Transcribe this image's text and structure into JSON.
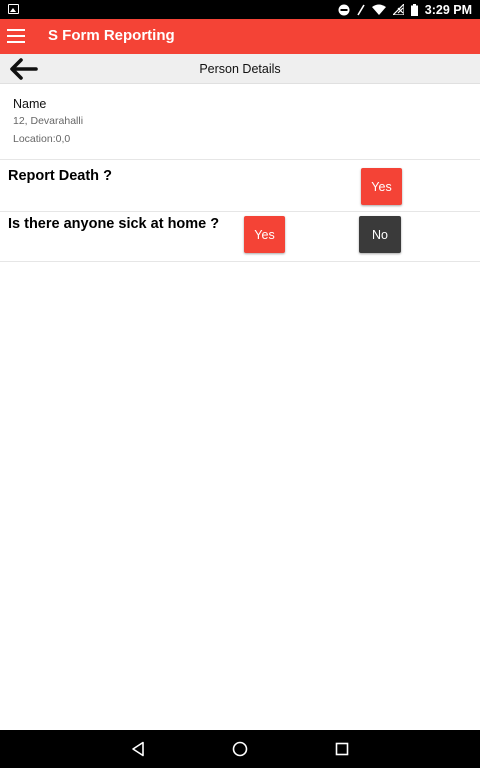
{
  "status_bar": {
    "time": "3:29 PM",
    "icons": [
      "image-notification-icon",
      "do-not-disturb-icon",
      "no-sim-icon",
      "wifi-icon",
      "signal-icon",
      "battery-icon"
    ]
  },
  "app_bar": {
    "title": "S Form Reporting",
    "color": "#f44336"
  },
  "sub_header": {
    "title": "Person Details"
  },
  "person": {
    "name": "Name",
    "address": "12, Devarahalli",
    "location": "Location:0,0"
  },
  "questions": [
    {
      "text": "Report Death ?",
      "yes_label": "Yes"
    },
    {
      "text": "Is there anyone sick at home ?",
      "yes_label": "Yes",
      "no_label": "No"
    }
  ],
  "colors": {
    "accent": "#f44336",
    "dark_button": "#3a3a3a"
  }
}
